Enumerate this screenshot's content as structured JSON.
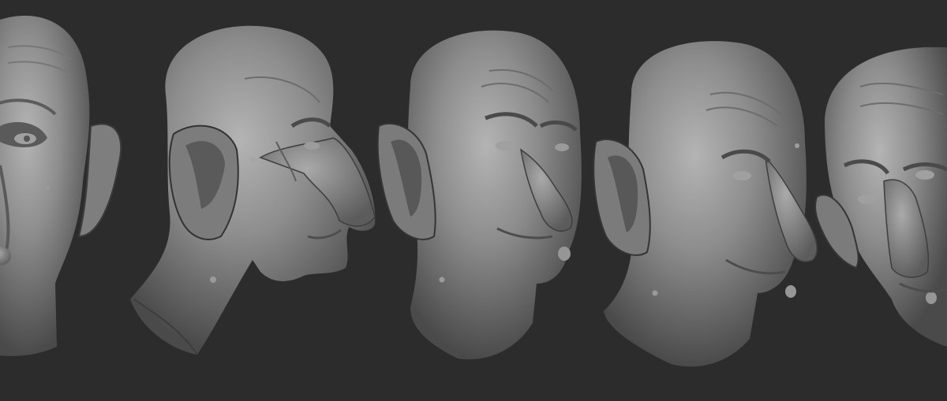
{
  "scene": {
    "background_color": "#2c2c2c",
    "material_color": "#8a8a8a",
    "subject": "clay-sculpt-old-man-head",
    "views": [
      {
        "name": "left-three-quarter-view"
      },
      {
        "name": "right-profile-view"
      },
      {
        "name": "right-three-quarter-view-a"
      },
      {
        "name": "right-three-quarter-view-b"
      },
      {
        "name": "front-three-quarter-view"
      }
    ]
  }
}
